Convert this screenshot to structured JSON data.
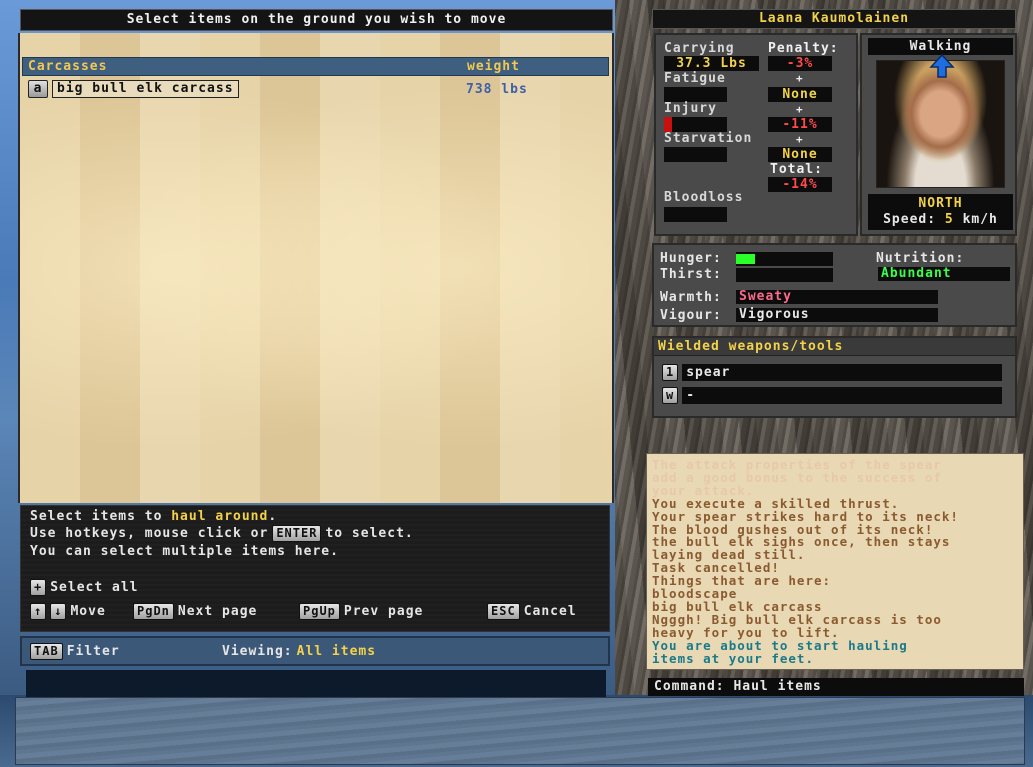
{
  "left_panel": {
    "title": "Select items on the ground you wish to move",
    "list_header": {
      "category": "Carcasses",
      "weight_col": "weight"
    },
    "items": [
      {
        "key": "a",
        "name": "big bull elk carcass",
        "weight": "738 lbs"
      }
    ],
    "help": {
      "line1_prefix": "Select items to ",
      "line1_highlight": "haul around",
      "line1_suffix": ".",
      "line2_prefix": "Use hotkeys, mouse click or",
      "line2_key": "ENTER",
      "line2_suffix": "to select.",
      "line3": "You can select multiple items here.",
      "select_all_key": "+",
      "select_all_label": "Select all",
      "up_key": "↑",
      "down_key": "↓",
      "move_label": "Move",
      "pgdn_key": "PgDn",
      "next_label": "Next page",
      "pgup_key": "PgUp",
      "prev_label": "Prev page",
      "esc_key": "ESC",
      "cancel_label": "Cancel"
    },
    "filter": {
      "tab_key": "TAB",
      "filter_label": "Filter",
      "viewing_label": "Viewing:",
      "viewing_value": "All items"
    }
  },
  "character": {
    "name": "Laana Kaumolainen",
    "carrying_label": "Carrying",
    "carrying_value": "37.3 Lbs",
    "fatigue_label": "Fatigue",
    "injury_label": "Injury",
    "starvation_label": "Starvation",
    "bloodloss_label": "Bloodloss",
    "penalty_label": "Penalty:",
    "penalty_carrying": "-3%",
    "penalty_fatigue": "None",
    "penalty_injury": "-11%",
    "penalty_starvation": "None",
    "total_label": "Total:",
    "total_value": "-14%",
    "plus": "+",
    "movement": "Walking",
    "direction": "NORTH",
    "speed_label": "Speed:",
    "speed_value": "5",
    "speed_unit": "km/h",
    "injury_level": 0.12
  },
  "needs": {
    "hunger_label": "Hunger:",
    "hunger_level": 0.2,
    "thirst_label": "Thirst:",
    "nutrition_label": "Nutrition:",
    "nutrition_value": "Abundant",
    "warmth_label": "Warmth:",
    "warmth_value": "Sweaty",
    "vigour_label": "Vigour:",
    "vigour_value": "Vigorous"
  },
  "weapons": {
    "title": "Wielded weapons/tools",
    "slots": [
      {
        "key": "1",
        "value": "spear"
      },
      {
        "key": "w",
        "value": "-"
      }
    ]
  },
  "log": {
    "faded": [
      "The attack properties of the spear",
      "add a good bonus to the success of",
      "your attack."
    ],
    "normal": [
      "You execute a skilled thrust.",
      "Your spear strikes hard to its neck!",
      "The blood gushes out of its neck!",
      "the bull elk sighs once, then stays",
      "laying dead still.",
      "Task cancelled!",
      "Things that are here:",
      "bloodscape",
      "big bull elk carcass",
      "Ngggh! Big bull elk carcass is too",
      "heavy for you to lift."
    ],
    "teal": [
      "You are about to start hauling",
      "items at your feet."
    ]
  },
  "command": {
    "label": "Command:",
    "value": "Haul items"
  },
  "colors": {
    "accent_yellow": "#f3d24a",
    "header_blue": "#3f5f80",
    "penalty_red": "#ff4a4a",
    "nutrition_green": "#3aff4a",
    "warmth_pink": "#ff6a8a",
    "log_teal": "#1a7a8a"
  }
}
